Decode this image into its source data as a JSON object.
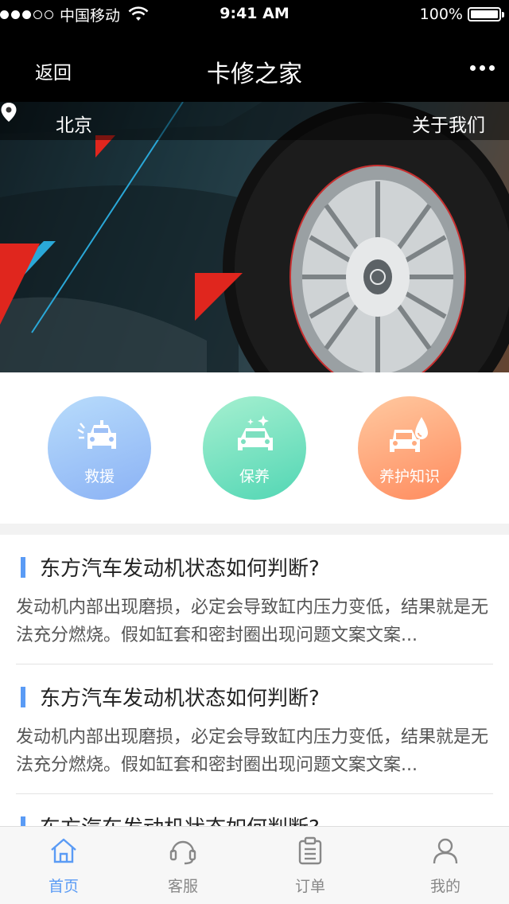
{
  "status_bar": {
    "carrier": "中国移动",
    "time": "9:41 AM",
    "battery": "100%",
    "battery_level": 1.0
  },
  "nav": {
    "back_label": "返回",
    "title": "卡修之家",
    "more_icon": "more-dots-icon"
  },
  "banner": {
    "location_icon": "location-pin-icon",
    "city": "北京",
    "about_label": "关于我们"
  },
  "services": [
    {
      "label": "救援",
      "icon": "rescue-car-icon"
    },
    {
      "label": "保养",
      "icon": "car-care-icon"
    },
    {
      "label": "养护知识",
      "icon": "car-oil-icon"
    }
  ],
  "articles": [
    {
      "title": "东方汽车发动机状态如何判断?",
      "summary": "发动机内部出现磨损，必定会导致缸内压力变低，结果就是无法充分燃烧。假如缸套和密封圈出现问题文案文案..."
    },
    {
      "title": "东方汽车发动机状态如何判断?",
      "summary": "发动机内部出现磨损，必定会导致缸内压力变低，结果就是无法充分燃烧。假如缸套和密封圈出现问题文案文案..."
    },
    {
      "title": "东方汽车发动机状态如何判断?",
      "summary": ""
    }
  ],
  "tabs": [
    {
      "label": "首页",
      "icon": "home-icon",
      "active": true
    },
    {
      "label": "客服",
      "icon": "headset-icon",
      "active": false
    },
    {
      "label": "订单",
      "icon": "clipboard-icon",
      "active": false
    },
    {
      "label": "我的",
      "icon": "user-icon",
      "active": false
    }
  ],
  "colors": {
    "accent": "#5a9bf5",
    "rescue": "#8bb2f5",
    "maintenance": "#52d6b4",
    "knowledge": "#ff8b5e"
  }
}
